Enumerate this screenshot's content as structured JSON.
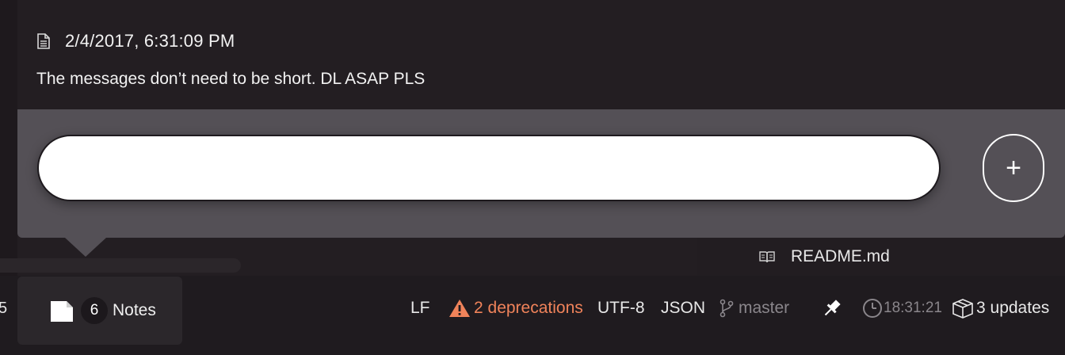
{
  "note": {
    "timestamp": "2/4/2017, 6:31:09 PM",
    "message": "The messages don’t need to be short. DL ASAP PLS"
  },
  "composer": {
    "input_value": "",
    "add_label": "+"
  },
  "tree": {
    "file_name": "README.md"
  },
  "status_bar": {
    "left_clipped_text": "5",
    "notes_count": "6",
    "notes_label": "Notes",
    "line_ending": "LF",
    "deprecations": "2 deprecations",
    "encoding": "UTF-8",
    "grammar": "JSON",
    "branch": "master",
    "clock": "18:31:21",
    "updates": "3 updates"
  },
  "colors": {
    "composer_bg": "#545056",
    "warning": "#f0835a",
    "dim_text": "#8a868b",
    "background": "#1f1b1f"
  },
  "icons": [
    "document-icon",
    "plus-icon",
    "book-icon",
    "page-icon",
    "warning-icon",
    "git-branch-icon",
    "pin-icon",
    "clock-icon",
    "package-icon"
  ]
}
